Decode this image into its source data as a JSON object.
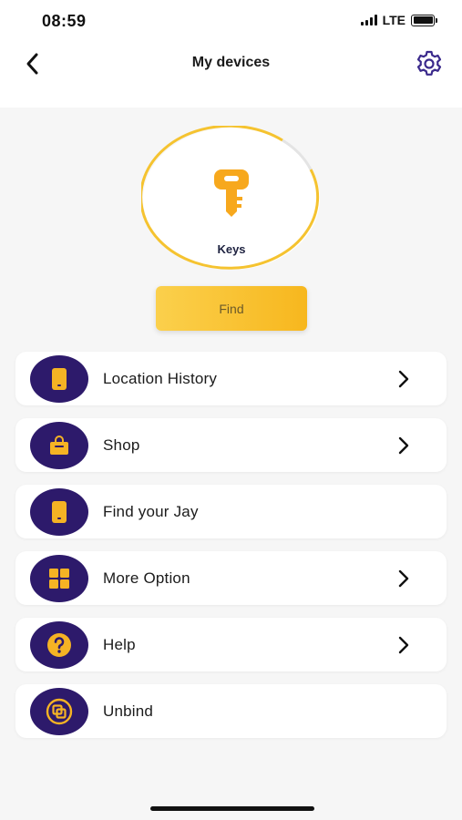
{
  "status_bar": {
    "time": "08:59",
    "network": "LTE"
  },
  "header": {
    "title": "My devices",
    "back_icon": "chevron-left-icon",
    "settings_icon": "gear-icon"
  },
  "device": {
    "name": "Keys",
    "icon": "key-icon"
  },
  "find_button": {
    "label": "Find"
  },
  "menu": {
    "items": [
      {
        "label": "Location History",
        "icon": "phone-icon",
        "has_chevron": true
      },
      {
        "label": "Shop",
        "icon": "shopping-bag-icon",
        "has_chevron": true
      },
      {
        "label": "Find your Jay",
        "icon": "phone-icon",
        "has_chevron": false
      },
      {
        "label": "More Option",
        "icon": "grid-icon",
        "has_chevron": true
      },
      {
        "label": "Help",
        "icon": "question-icon",
        "has_chevron": true
      },
      {
        "label": "Unbind",
        "icon": "unbind-icon",
        "has_chevron": false
      }
    ]
  },
  "colors": {
    "accent_yellow": "#f7b71e",
    "icon_bg_purple": "#2d1a6b",
    "settings_purple": "#3b2a8c"
  }
}
